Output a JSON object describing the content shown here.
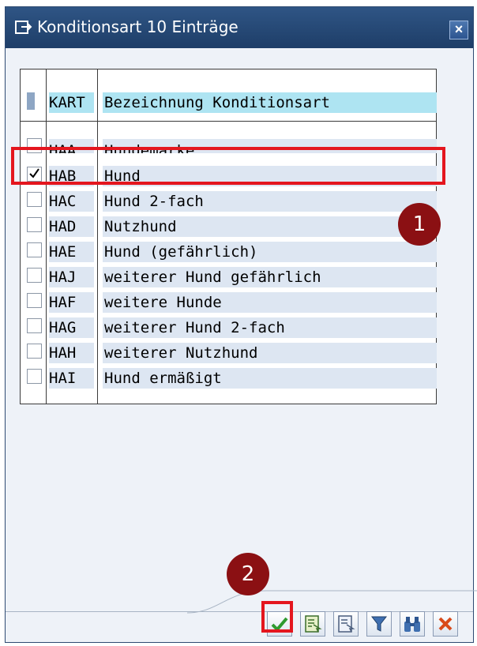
{
  "dialog": {
    "title": "Konditionsart 10 Einträge",
    "close_symbol": "×"
  },
  "table": {
    "columns": [
      "KART",
      "Bezeichnung Konditionsart"
    ],
    "rows": [
      {
        "code": "HAA",
        "desc": "Hundemarke",
        "checked": false
      },
      {
        "code": "HAB",
        "desc": "Hund",
        "checked": true
      },
      {
        "code": "HAC",
        "desc": "Hund 2-fach",
        "checked": false
      },
      {
        "code": "HAD",
        "desc": "Nutzhund",
        "checked": false
      },
      {
        "code": "HAE",
        "desc": "Hund (gefährlich)",
        "checked": false
      },
      {
        "code": "HAJ",
        "desc": "weiterer Hund gefährlich",
        "checked": false
      },
      {
        "code": "HAF",
        "desc": "weitere Hunde",
        "checked": false
      },
      {
        "code": "HAG",
        "desc": "weiterer Hund 2-fach",
        "checked": false
      },
      {
        "code": "HAH",
        "desc": "weiterer Nutzhund",
        "checked": false
      },
      {
        "code": "HAI",
        "desc": "Hund ermäßigt",
        "checked": false
      }
    ]
  },
  "annotations": {
    "badge1": "1",
    "badge2": "2"
  },
  "toolbar": {
    "buttons": [
      "checkmark-icon",
      "details-icon",
      "info-icon",
      "filter-icon",
      "binoculars-icon",
      "cancel-x-icon"
    ]
  },
  "colors": {
    "titlebar": "#1e3e68",
    "highlight": "#e4161e",
    "badge": "#8b1013",
    "header_cell": "#aee4f2",
    "row_cell": "#dde6f2"
  }
}
